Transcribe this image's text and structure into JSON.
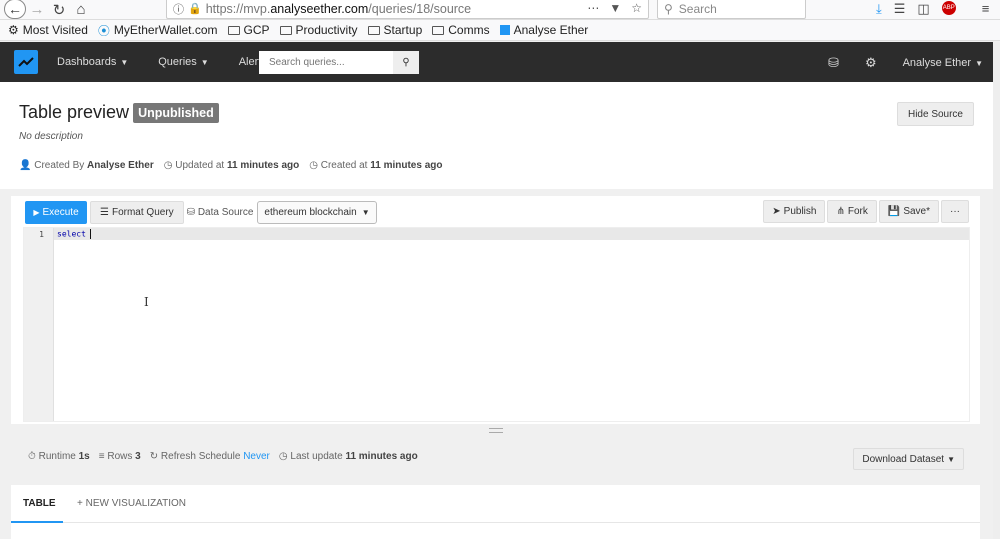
{
  "browser": {
    "url_prefix": "https://mvp.",
    "url_host": "analyseether.com",
    "url_path": "/queries/18/source",
    "search_placeholder": "Search"
  },
  "bookmarks": [
    {
      "label": "Most Visited",
      "icon": "gear-icon"
    },
    {
      "label": "MyEtherWallet.com",
      "icon": "wallet-icon"
    },
    {
      "label": "GCP",
      "icon": "folder-icon"
    },
    {
      "label": "Productivity",
      "icon": "folder-icon"
    },
    {
      "label": "Startup",
      "icon": "folder-icon"
    },
    {
      "label": "Comms",
      "icon": "folder-icon"
    },
    {
      "label": "Analyse Ether",
      "icon": "chart-icon"
    }
  ],
  "navbar": {
    "dashboards": "Dashboards",
    "queries": "Queries",
    "alerts": "Alerts",
    "search_placeholder": "Search queries...",
    "user": "Analyse Ether"
  },
  "header": {
    "title": "Table preview",
    "badge": "Unpublished",
    "description": "No description",
    "created_by_label": "Created By",
    "created_by": "Analyse Ether",
    "updated_label": "Updated at",
    "updated": "11 minutes ago",
    "created_label": "Created at",
    "created": "11 minutes ago",
    "hide_source": "Hide Source"
  },
  "editor": {
    "execute": "Execute",
    "format": "Format Query",
    "data_source_label": "Data Source",
    "data_source": "ethereum blockchain",
    "publish": "Publish",
    "fork": "Fork",
    "save": "Save*",
    "more": "···",
    "line_number": "1",
    "code": "select"
  },
  "results": {
    "runtime_label": "Runtime",
    "runtime": "1s",
    "rows_label": "Rows",
    "rows": "3",
    "refresh_label": "Refresh Schedule",
    "refresh": "Never",
    "last_update_label": "Last update",
    "last_update": "11 minutes ago",
    "download": "Download Dataset"
  },
  "tabs": {
    "table": "TABLE",
    "new_viz": "+ NEW VISUALIZATION"
  }
}
